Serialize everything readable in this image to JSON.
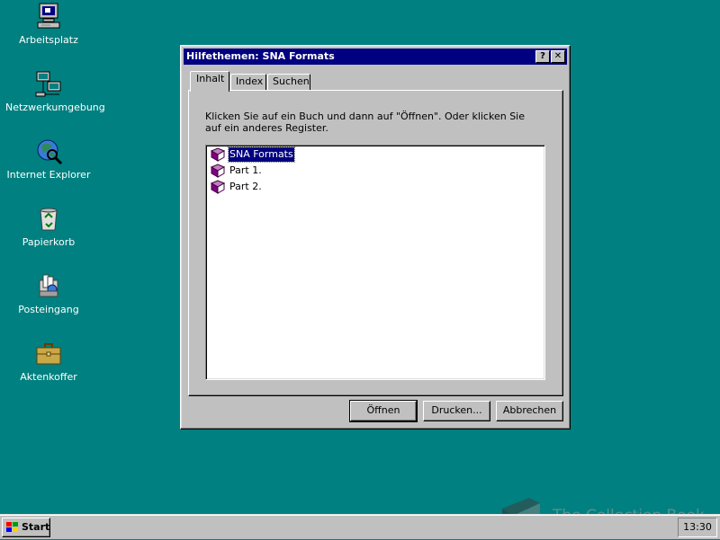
{
  "desktop": {
    "icons": [
      {
        "label": "Arbeitsplatz",
        "icon": "my-computer-icon"
      },
      {
        "label": "Netzwerkumgebung",
        "icon": "network-neighborhood-icon"
      },
      {
        "label": "Internet Explorer",
        "icon": "internet-explorer-icon"
      },
      {
        "label": "Papierkorb",
        "icon": "recycle-bin-icon"
      },
      {
        "label": "Posteingang",
        "icon": "inbox-icon"
      },
      {
        "label": "Aktenkoffer",
        "icon": "briefcase-icon"
      }
    ],
    "background_color": "#008080"
  },
  "dialog": {
    "title": "Hilfethemen: SNA Formats",
    "help_button": "?",
    "close_button": "✕",
    "tabs": [
      {
        "label": "Inhalt",
        "active": true
      },
      {
        "label": "Index",
        "active": false
      },
      {
        "label": "Suchen",
        "active": false
      }
    ],
    "instructions": "Klicken Sie auf ein Buch und dann auf \"Öffnen\". Oder klicken Sie auf ein anderes Register.",
    "tree_items": [
      {
        "label": "SNA Formats",
        "icon": "book-icon",
        "selected": true
      },
      {
        "label": "Part 1.",
        "icon": "book-icon",
        "selected": false
      },
      {
        "label": "Part 2.",
        "icon": "book-icon",
        "selected": false
      }
    ],
    "buttons": {
      "open": "Öffnen",
      "print": "Drucken...",
      "cancel": "Abbrechen"
    },
    "title_color": "#000080"
  },
  "taskbar": {
    "start_label": "Start",
    "clock": "13:30"
  },
  "watermark": {
    "text": "The Collection Book"
  }
}
